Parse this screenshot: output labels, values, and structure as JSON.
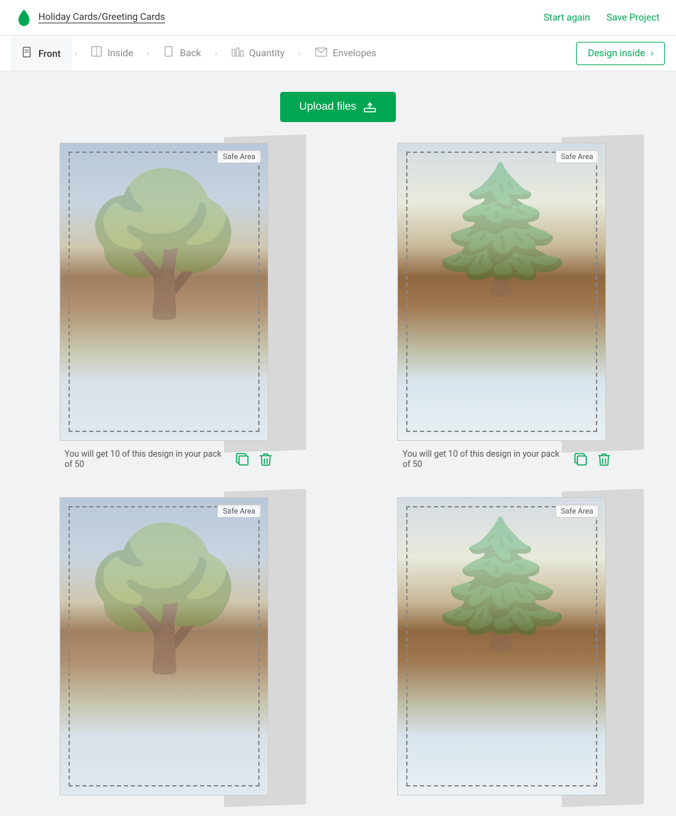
{
  "header": {
    "logo_alt": "GreenPrint logo",
    "breadcrumb": "Holiday Cards/Greeting Cards",
    "start_again": "Start again",
    "save_project": "Save Project"
  },
  "steps": {
    "front": "Front",
    "inside": "Inside",
    "back": "Back",
    "quantity": "Quantity",
    "envelopes": "Envelopes",
    "design_inside": "Design inside"
  },
  "upload_button": "Upload files",
  "cards": [
    {
      "id": 1,
      "safe_area": "Safe Area",
      "caption": "You will get 10 of this design in your pack of 50"
    },
    {
      "id": 2,
      "safe_area": "Safe Area",
      "caption": "You will get 10 of this design in your pack of 50"
    },
    {
      "id": 3,
      "safe_area": "Safe Area",
      "caption": ""
    },
    {
      "id": 4,
      "safe_area": "Safe Area",
      "caption": ""
    }
  ]
}
